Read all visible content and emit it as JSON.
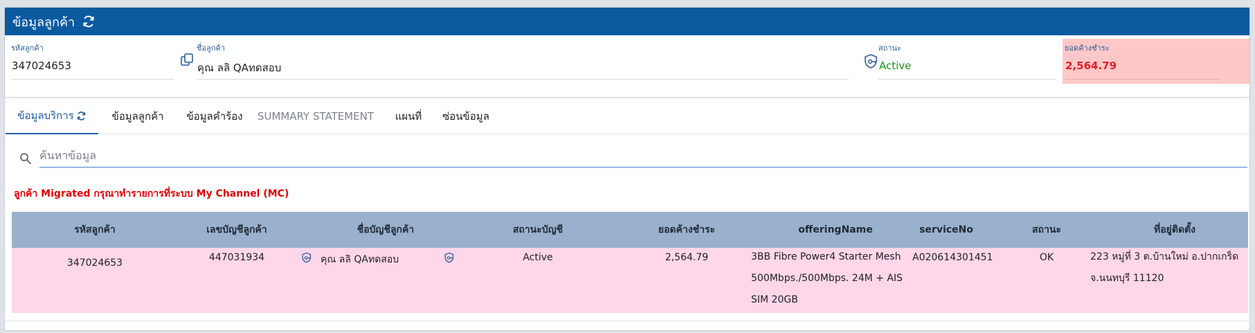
{
  "header": {
    "title": "ข้อมูลลูกค้า"
  },
  "customer": {
    "code_label": "รหัสลูกค้า",
    "code_value": "347024653",
    "name_label": "ชื่อลูกค้า",
    "name_value": "คุณ ลลิ QAทดสอบ",
    "status_label": "สถานะ",
    "status_value": "Active",
    "balance_label": "ยอดค้างชำระ",
    "balance_value": "2,564.79"
  },
  "tabs": [
    {
      "label": "ข้อมูลบริการ"
    },
    {
      "label": "ข้อมูลลูกค้า"
    },
    {
      "label": "ข้อมูลคำร้อง"
    },
    {
      "label": "SUMMARY STATEMENT"
    },
    {
      "label": "แผนที่"
    },
    {
      "label": "ซ่อนข้อมูล"
    }
  ],
  "search": {
    "placeholder": "ค้นหาข้อมูล"
  },
  "notice": "ลูกค้า Migrated กรุณาทำรายการที่ระบบ My Channel (MC)",
  "table": {
    "headers": [
      "รหัสลูกค้า",
      "เลขบัญชีลูกค้า",
      "ชื่อบัญชีลูกค้า",
      "สถานะบัญชี",
      "ยอดค้างชำระ",
      "offeringName",
      "serviceNo",
      "สถานะ",
      "ที่อยู่ติดตั้ง"
    ],
    "rows": [
      {
        "customer_code": "347024653",
        "account_no": "447031934",
        "account_name": "คุณ ลลิ QAทดสอบ",
        "account_status": "Active",
        "balance": "2,564.79",
        "offering_name": "3BB Fibre Power4 Starter Mesh 500Mbps./500Mbps. 24M + AIS SIM 20GB",
        "service_no": "A020614301451",
        "status": "OK",
        "address": "223 หมู่ที่ 3 ต.บ้านใหม่ อ.ปากเกร็ด จ.นนทบุรี 11120"
      }
    ]
  },
  "colors": {
    "header_bg": "#0b5aa0",
    "active_status": "#1e8e1e",
    "balance_text": "#e0202a",
    "balance_bg": "#ffc8c8",
    "table_header_bg": "#99b1cc",
    "row_bg": "#ffd6ea",
    "notice_text": "#e00000"
  }
}
